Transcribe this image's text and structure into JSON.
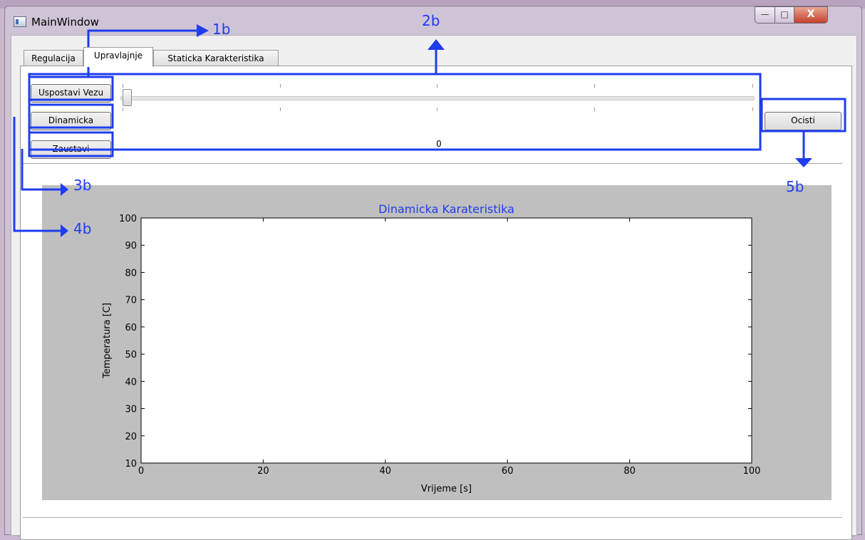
{
  "window": {
    "title": "MainWindow",
    "controls": {
      "minimize": "—",
      "maximize": "□",
      "close": "X"
    }
  },
  "tabs": [
    {
      "label": "Regulacija"
    },
    {
      "label": "Upravlajnje",
      "active": true
    },
    {
      "label": "Staticka Karakteristika"
    }
  ],
  "buttons": {
    "connect": "Uspostavi Vezu",
    "dynamic": "Dinamicka",
    "stop": "Zaustavi",
    "clear": "Ocisti"
  },
  "slider": {
    "value": "0",
    "fraction": 0.0
  },
  "annotations": {
    "a1": "1b",
    "a2": "2b",
    "a3": "3b",
    "a4": "4b",
    "a5": "5b",
    "color": "#1f3cf0"
  },
  "chart_data": {
    "type": "line",
    "title": "Dinamicka Karateristika",
    "xlabel": "Vrijeme [s]",
    "ylabel": "Temperatura [C]",
    "xlim": [
      0,
      100
    ],
    "ylim": [
      10,
      100
    ],
    "xticks": [
      "0",
      "20",
      "40",
      "60",
      "80",
      "100"
    ],
    "yticks": [
      "10",
      "20",
      "30",
      "40",
      "50",
      "60",
      "70",
      "80",
      "90",
      "100"
    ],
    "series": [],
    "grid": false,
    "title_color": "#1f3cf0"
  }
}
